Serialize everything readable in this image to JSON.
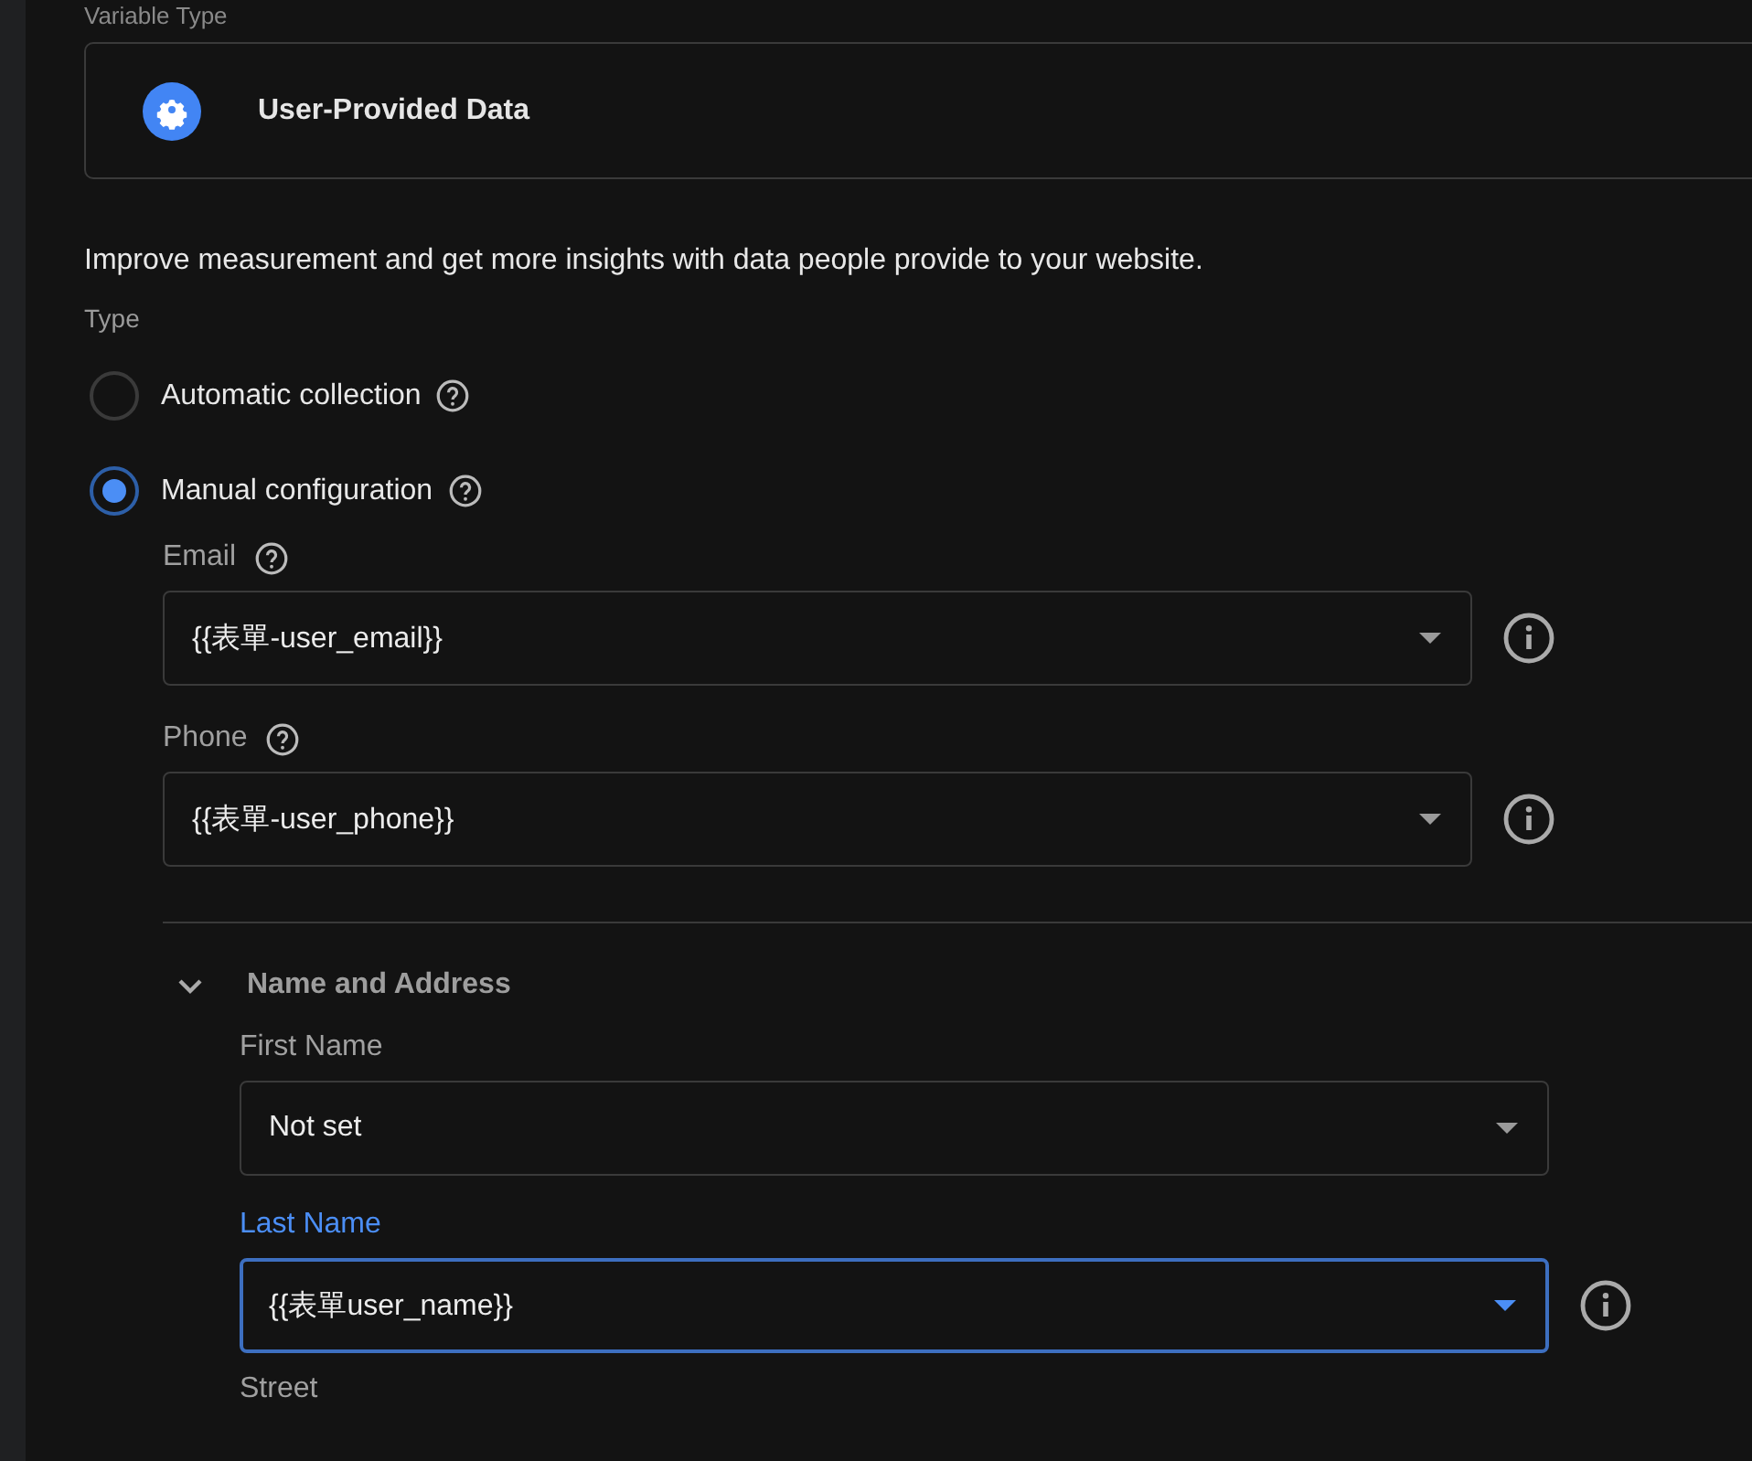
{
  "section_label": "Variable Type",
  "variable_type": {
    "name": "User-Provided Data"
  },
  "description": "Improve measurement and get more insights with data people provide to your website.",
  "type_label": "Type",
  "options": [
    {
      "label": "Automatic collection",
      "selected": false
    },
    {
      "label": "Manual configuration",
      "selected": true
    }
  ],
  "fields": [
    {
      "label": "Email",
      "help": true,
      "value": "{{表單-user_email}}",
      "focused": false,
      "info": true
    },
    {
      "label": "Phone",
      "help": true,
      "value": "{{表單-user_phone}}",
      "focused": false,
      "info": true
    }
  ],
  "group": {
    "title": "Name and Address",
    "expanded": true,
    "fields": [
      {
        "label": "First Name",
        "help": false,
        "value": "Not set",
        "focused": false,
        "info": false
      },
      {
        "label": "Last Name",
        "help": false,
        "value": "{{表單user_name}}",
        "focused": true,
        "info": true
      }
    ],
    "next_label": "Street"
  }
}
